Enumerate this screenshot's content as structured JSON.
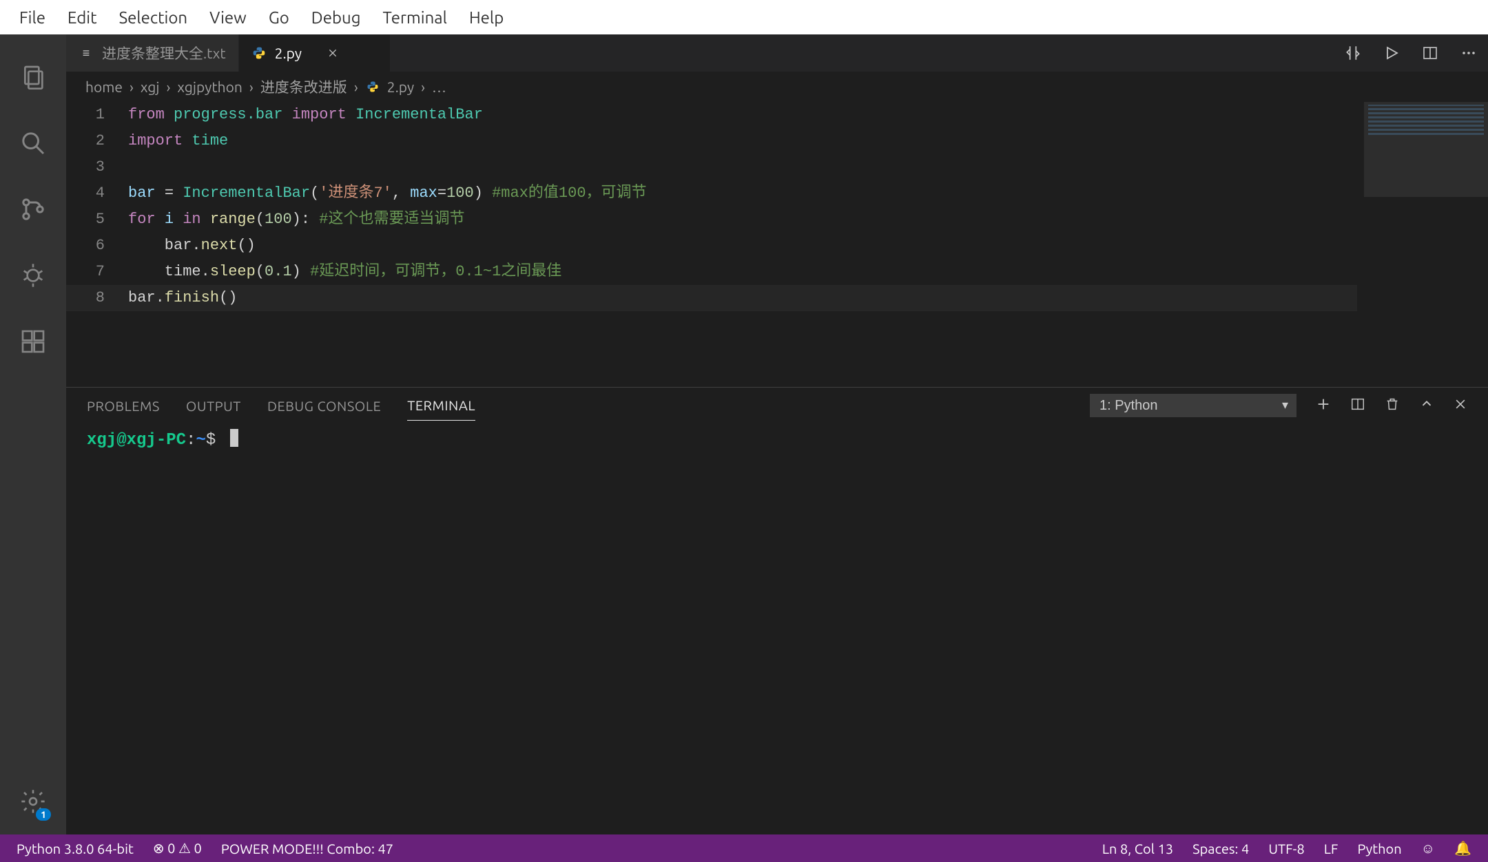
{
  "menubar": [
    "File",
    "Edit",
    "Selection",
    "View",
    "Go",
    "Debug",
    "Terminal",
    "Help"
  ],
  "tabs": [
    {
      "label": "进度条整理大全.txt",
      "icon": "text",
      "active": false,
      "closable": false
    },
    {
      "label": "2.py",
      "icon": "python",
      "active": true,
      "closable": true
    }
  ],
  "breadcrumbs": [
    "home",
    "xgj",
    "xgjpython",
    "进度条改进版",
    "2.py",
    "…"
  ],
  "code": {
    "lines": [
      {
        "n": 1,
        "segments": [
          {
            "t": "from ",
            "c": "kw"
          },
          {
            "t": "progress.bar ",
            "c": "mod"
          },
          {
            "t": "import ",
            "c": "kw"
          },
          {
            "t": "IncrementalBar",
            "c": "cls"
          }
        ]
      },
      {
        "n": 2,
        "segments": [
          {
            "t": "import ",
            "c": "kw"
          },
          {
            "t": "time",
            "c": "mod"
          }
        ]
      },
      {
        "n": 3,
        "segments": [
          {
            "t": "",
            "c": ""
          }
        ]
      },
      {
        "n": 4,
        "segments": [
          {
            "t": "bar ",
            "c": "var"
          },
          {
            "t": "= ",
            "c": ""
          },
          {
            "t": "IncrementalBar",
            "c": "cls"
          },
          {
            "t": "(",
            "c": ""
          },
          {
            "t": "'进度条7'",
            "c": "str"
          },
          {
            "t": ", ",
            "c": ""
          },
          {
            "t": "max",
            "c": "var"
          },
          {
            "t": "=",
            "c": ""
          },
          {
            "t": "100",
            "c": "num"
          },
          {
            "t": ") ",
            "c": ""
          },
          {
            "t": "#max的值100，可调节",
            "c": "com"
          }
        ]
      },
      {
        "n": 5,
        "segments": [
          {
            "t": "for ",
            "c": "kw"
          },
          {
            "t": "i ",
            "c": "var"
          },
          {
            "t": "in ",
            "c": "kw"
          },
          {
            "t": "range",
            "c": "fn"
          },
          {
            "t": "(",
            "c": ""
          },
          {
            "t": "100",
            "c": "num"
          },
          {
            "t": "): ",
            "c": ""
          },
          {
            "t": "#这个也需要适当调节",
            "c": "com"
          }
        ]
      },
      {
        "n": 6,
        "segments": [
          {
            "t": "    bar.",
            "c": ""
          },
          {
            "t": "next",
            "c": "fn"
          },
          {
            "t": "()",
            "c": ""
          }
        ]
      },
      {
        "n": 7,
        "segments": [
          {
            "t": "    time.",
            "c": ""
          },
          {
            "t": "sleep",
            "c": "fn"
          },
          {
            "t": "(",
            "c": ""
          },
          {
            "t": "0.1",
            "c": "num"
          },
          {
            "t": ") ",
            "c": ""
          },
          {
            "t": "#延迟时间，可调节，0.1~1之间最佳",
            "c": "com"
          }
        ]
      },
      {
        "n": 8,
        "segments": [
          {
            "t": "bar.",
            "c": ""
          },
          {
            "t": "finish",
            "c": "fn"
          },
          {
            "t": "()",
            "c": ""
          }
        ]
      }
    ]
  },
  "panel": {
    "tabs": [
      "PROBLEMS",
      "OUTPUT",
      "DEBUG CONSOLE",
      "TERMINAL"
    ],
    "active_tab": "TERMINAL",
    "terminal_select": "1: Python",
    "prompt": {
      "user": "xgj@xgj-PC",
      "path": "~",
      "dollar": "$"
    }
  },
  "activity_badge": "1",
  "statusbar": {
    "left": [
      "Python 3.8.0 64-bit",
      "⊗ 0 ⚠ 0",
      "POWER MODE!!! Combo: 47"
    ],
    "right": [
      "Ln 8, Col 13",
      "Spaces: 4",
      "UTF-8",
      "LF",
      "Python",
      "☺",
      "🔔"
    ]
  }
}
